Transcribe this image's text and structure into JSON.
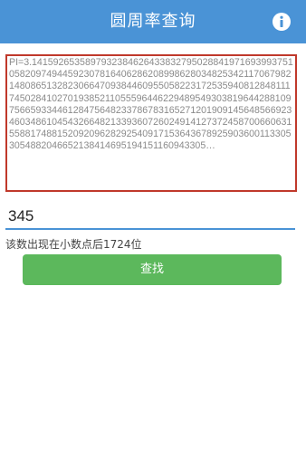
{
  "header": {
    "title": "圆周率查询",
    "info_icon": "info-icon"
  },
  "pi_display": {
    "text": "PI=3.14159265358979323846264338327950288419716939937510582097494459230781640628620899862803482534211706798214808651328230664709384460955058223172535940812848111745028410270193852110555964462294895493038196442881097566593344612847564823378678316527120190914564856692346034861045432664821339360726024914127372458700660631558817488152092096282925409171536436789259036001133053054882046652138414695194151160943305…"
  },
  "search": {
    "value": "345"
  },
  "result": {
    "text": "该数出现在小数点后1724位"
  },
  "actions": {
    "search_label": "查找"
  },
  "colors": {
    "header_bg": "#4a93d6",
    "button_bg": "#5cb85c",
    "box_border": "#c0392b"
  }
}
